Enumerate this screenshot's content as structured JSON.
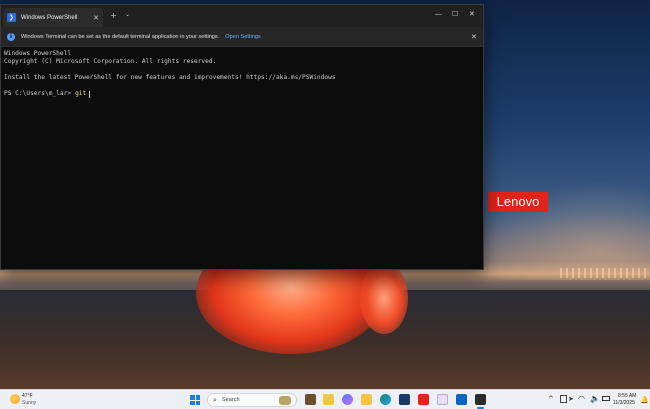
{
  "terminal": {
    "tab_title": "Windows PowerShell",
    "tab_close": "✕",
    "new_tab": "+",
    "dropdown": "⌄",
    "minimize": "—",
    "maximize": "☐",
    "close": "✕",
    "info_bar": {
      "message": "Windows Terminal can be set as the default terminal application in your settings.",
      "link": "Open Settings",
      "close": "✕"
    },
    "lines": [
      "Windows PowerShell",
      "Copyright (C) Microsoft Corporation. All rights reserved.",
      "Install the latest PowerShell for new features and improvements! https://aka.ms/PSWindows"
    ],
    "prompt": "PS C:\\Users\\m_lar>",
    "command": "git"
  },
  "desktop": {
    "logo": "Lenovo"
  },
  "taskbar": {
    "weather": {
      "temp": "47°F",
      "condition": "Sunny"
    },
    "search_placeholder": "Search",
    "clock": {
      "time": "8:55 AM",
      "date": "11/3/2025"
    }
  },
  "colors": {
    "terminal_bg": "#0c0c0c",
    "tab_bar_bg": "#202020",
    "info_bar_bg": "#262626",
    "link_color": "#6cb4ff",
    "command_color": "#f2e88a",
    "lenovo_red": "#e2231a",
    "taskbar_bg": "#edf1f5"
  }
}
